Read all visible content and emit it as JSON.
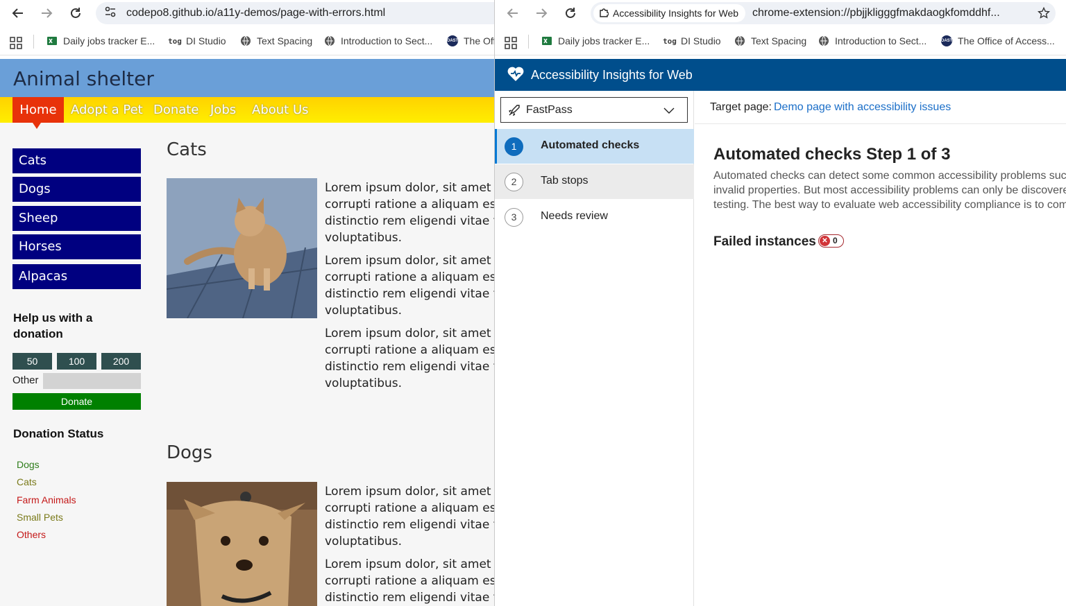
{
  "left_window": {
    "url": "codepo8.github.io/a11y-demos/page-with-errors.html",
    "bookmarks": [
      {
        "label": "Daily jobs tracker E...",
        "icon": "excel-icon"
      },
      {
        "label": "DI Studio",
        "icon": "tog-icon",
        "icon_text": "tog"
      },
      {
        "label": "Text Spacing",
        "icon": "globe-icon"
      },
      {
        "label": "Introduction to Sect...",
        "icon": "globe-icon"
      },
      {
        "label": "The Off",
        "icon": "oast-icon",
        "icon_text": "OAST"
      }
    ]
  },
  "right_window": {
    "tab_chip": "Accessibility Insights for Web",
    "url": "chrome-extension://pbjjkligggfmakdaogkfomddhf...",
    "bookmarks": [
      {
        "label": "Daily jobs tracker E...",
        "icon": "excel-icon"
      },
      {
        "label": "DI Studio",
        "icon": "tog-icon",
        "icon_text": "tog"
      },
      {
        "label": "Text Spacing",
        "icon": "globe-icon"
      },
      {
        "label": "Introduction to Sect...",
        "icon": "globe-icon"
      },
      {
        "label": "The Office of Access...",
        "icon": "oast-icon",
        "icon_text": "OAST"
      }
    ]
  },
  "site": {
    "title": "Animal shelter",
    "nav": [
      "Home",
      "Adopt a Pet",
      "Donate",
      "Jobs",
      "About Us"
    ],
    "animals": [
      "Cats",
      "Dogs",
      "Sheep",
      "Horses",
      "Alpacas"
    ],
    "help_title": "Help us with a donation",
    "amounts": [
      "50",
      "100",
      "200"
    ],
    "other_label": "Other",
    "donate_label": "Donate",
    "status_title": "Donation Status",
    "status_items": [
      {
        "label": "Dogs",
        "color": "#2e7d1a"
      },
      {
        "label": "Cats",
        "color": "#7a7a1a"
      },
      {
        "label": "Farm Animals",
        "color": "#c41818"
      },
      {
        "label": "Small Pets",
        "color": "#7a7a1a"
      },
      {
        "label": "Others",
        "color": "#c41818"
      }
    ],
    "sections": [
      {
        "heading": "Cats",
        "paragraphs": [
          [
            "Lorem ipsum dolor, sit amet c",
            "corrupti ratione a aliquam est",
            "distinctio rem eligendi vitae te",
            "voluptatibus."
          ],
          [
            "Lorem ipsum dolor, sit amet c",
            "corrupti ratione a aliquam est",
            "distinctio rem eligendi vitae te",
            "voluptatibus."
          ],
          [
            "Lorem ipsum dolor, sit amet c",
            "corrupti ratione a aliquam est",
            "distinctio rem eligendi vitae te",
            "voluptatibus."
          ]
        ]
      },
      {
        "heading": "Dogs",
        "paragraphs": [
          [
            "Lorem ipsum dolor, sit amet c",
            "corrupti ratione a aliquam est",
            "distinctio rem eligendi vitae te",
            "voluptatibus."
          ],
          [
            "Lorem ipsum dolor, sit amet c",
            "corrupti ratione a aliquam est",
            "distinctio rem eligendi vitae te"
          ]
        ]
      }
    ]
  },
  "insights": {
    "title": "Accessibility Insights for Web",
    "mode": "FastPass",
    "steps": [
      {
        "num": "1",
        "label": "Automated checks",
        "state": "selected"
      },
      {
        "num": "2",
        "label": "Tab stops",
        "state": "hover"
      },
      {
        "num": "3",
        "label": "Needs review",
        "state": "normal"
      }
    ],
    "target_label": "Target page:",
    "target_link": "Demo page with accessibility issues",
    "heading": "Automated checks Step 1 of 3",
    "description": [
      "Automated checks can detect some common accessibility problems suc",
      "invalid properties. But most accessibility problems can only be discovere",
      "testing. The best way to evaluate web accessibility compliance is to com"
    ],
    "failed_label": "Failed instances",
    "failed_count": "0"
  }
}
